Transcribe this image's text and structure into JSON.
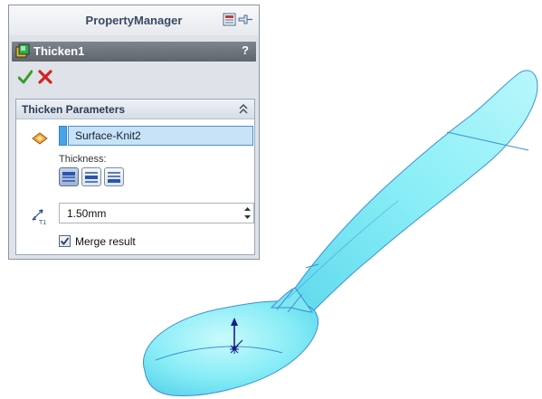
{
  "property_manager": {
    "title": "PropertyManager",
    "feature_name": "Thicken1",
    "help_label": "?",
    "accept_icon": "green-check-icon",
    "cancel_icon": "red-x-icon"
  },
  "thicken_parameters": {
    "title": "Thicken Parameters",
    "selection": "Surface-Knit2",
    "thickness_label": "Thickness:",
    "thickness_options": [
      "thicken-side-1",
      "thicken-both-sides",
      "thicken-side-2"
    ],
    "selected_option": "thicken-side-1",
    "thickness_value": "1.50mm",
    "merge_result_label": "Merge result",
    "merge_result_checked": true
  },
  "colors": {
    "model_fill": "#7fe6f2",
    "model_edge": "#3a8fd4",
    "triad": "#1b1b8c",
    "panel_bg": "#dfe3e9",
    "feature_bar": "#6b7179",
    "selection_fill": "#c8e3f7"
  }
}
